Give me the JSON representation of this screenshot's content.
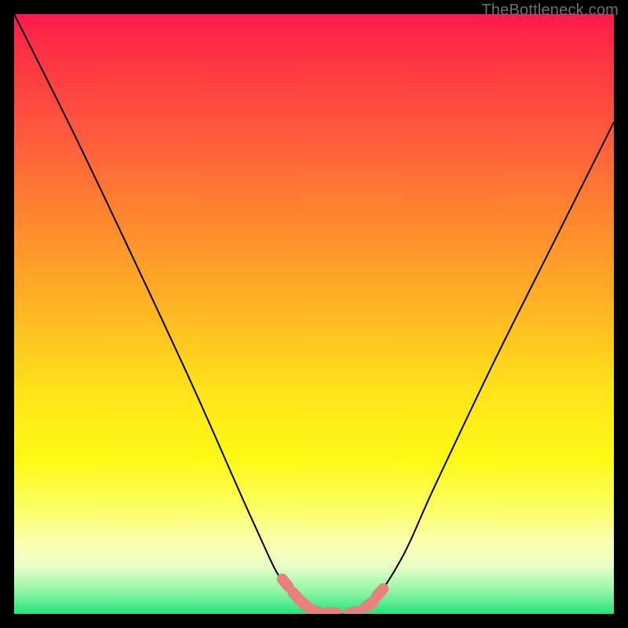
{
  "watermark": "TheBottleneck.com",
  "chart_data": {
    "type": "line",
    "title": "",
    "xlabel": "",
    "ylabel": "",
    "xlim": [
      0,
      100
    ],
    "ylim": [
      0,
      100
    ],
    "series": [
      {
        "name": "bottleneck-curve",
        "x": [
          0,
          10,
          20,
          30,
          40,
          45,
          50,
          52,
          54,
          56,
          58,
          60,
          65,
          70,
          80,
          90,
          100
        ],
        "values": [
          100,
          80,
          59,
          37.5,
          15,
          5,
          0.7,
          0,
          0,
          0,
          0.5,
          2,
          10,
          21,
          42,
          62,
          82
        ]
      }
    ],
    "markers": [
      {
        "name": "left-cap-1",
        "x": 45.2,
        "y": 5.2
      },
      {
        "name": "left-cap-2",
        "x": 47.0,
        "y": 3.0
      },
      {
        "name": "left-dot",
        "x": 48.3,
        "y": 1.7
      },
      {
        "name": "flat-start",
        "x": 50.0,
        "y": 0.6
      },
      {
        "name": "flat-mid",
        "x": 53.0,
        "y": 0.2
      },
      {
        "name": "flat-end",
        "x": 56.5,
        "y": 0.3
      },
      {
        "name": "right-cap-1",
        "x": 59.2,
        "y": 1.6
      },
      {
        "name": "right-cap-2",
        "x": 61.0,
        "y": 3.6
      }
    ],
    "marker_color": "#e88080"
  }
}
